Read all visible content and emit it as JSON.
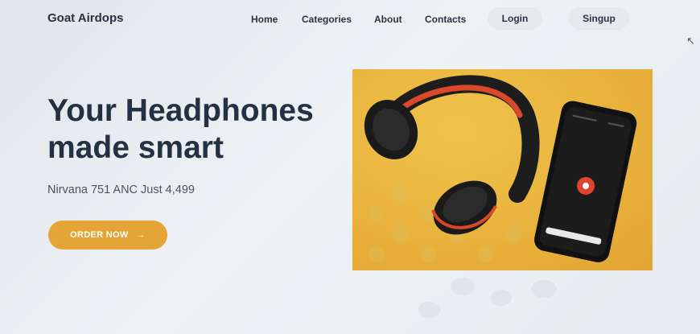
{
  "nav": {
    "brand": "Goat Airdops",
    "links": [
      "Home",
      "Categories",
      "About",
      "Contacts"
    ],
    "login": "Login",
    "signup": "Singup"
  },
  "hero": {
    "title_line1": "Your Headphones",
    "title_line2": "made smart",
    "subtitle": "Nirvana 751 ANC Just 4,499",
    "cta_label": "ORDER NOW",
    "cta_arrow": "→"
  },
  "colors": {
    "accent": "#e4a436",
    "image_bg": "#eab63e",
    "headphone_band": "#d9482a",
    "phone_button": "#e0442c"
  },
  "icons": {
    "cursor": "mouse-cursor-icon",
    "arrow": "arrow-right-icon",
    "record": "record-icon"
  }
}
